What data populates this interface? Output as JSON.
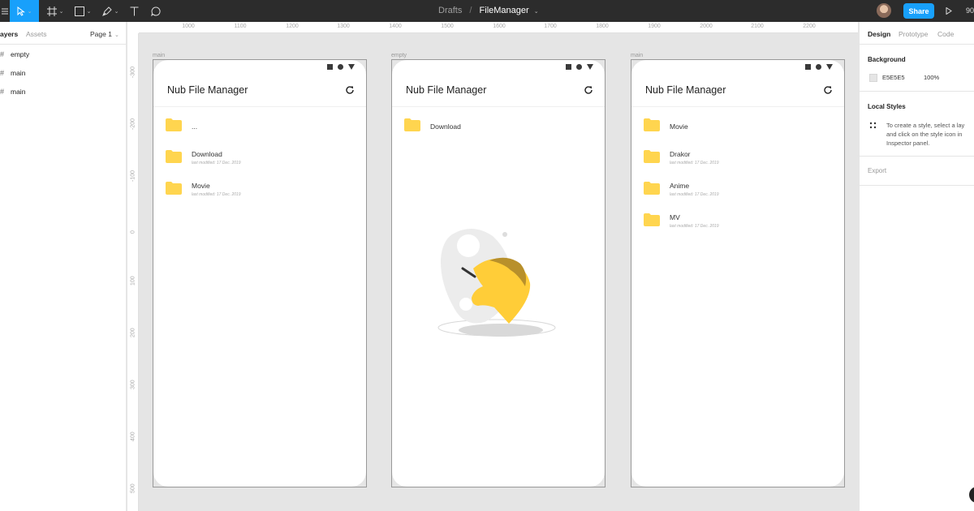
{
  "toolbar": {
    "doc_drafts": "Drafts",
    "doc_sep": "/",
    "doc_name": "FileManager",
    "share_label": "Share",
    "zoom_label": "90"
  },
  "left_panel": {
    "tab_layers": "ayers",
    "tab_assets": "Assets",
    "page_label": "Page 1",
    "layers": [
      {
        "name": "empty"
      },
      {
        "name": "main"
      },
      {
        "name": "main"
      }
    ]
  },
  "canvas": {
    "ruler_top": [
      "1000",
      "1100",
      "1200",
      "1300",
      "1400",
      "1500",
      "1600",
      "1700",
      "1800",
      "1900",
      "2000",
      "2100",
      "2200"
    ],
    "ruler_left": [
      "-300",
      "-200",
      "-100",
      "0",
      "100",
      "200",
      "300",
      "400",
      "500"
    ],
    "frames": [
      {
        "label": "main",
        "title": "Nub File Manager",
        "items": [
          {
            "name": "...",
            "meta": ""
          },
          {
            "name": "Download",
            "meta": "last modified: 17 Dec. 2019"
          },
          {
            "name": "Movie",
            "meta": "last modified: 17 Dec. 2019"
          }
        ]
      },
      {
        "label": "empty",
        "title": "Nub File Manager",
        "items": [
          {
            "name": "Download",
            "meta": ""
          }
        ]
      },
      {
        "label": "main",
        "title": "Nub File Manager",
        "items": [
          {
            "name": "Movie",
            "meta": ""
          },
          {
            "name": "Drakor",
            "meta": "last modified: 17 Dec. 2019"
          },
          {
            "name": "Anime",
            "meta": "last modified: 17 Dec. 2019"
          },
          {
            "name": "MV",
            "meta": "last modified: 17 Dec. 2019"
          }
        ]
      }
    ]
  },
  "right_panel": {
    "tab_design": "Design",
    "tab_prototype": "Prototype",
    "tab_code": "Code",
    "background_heading": "Background",
    "background_hex": "E5E5E5",
    "background_opacity": "100%",
    "local_styles_heading": "Local Styles",
    "local_styles_help": [
      "To create a style, select a lay",
      "and click on the style icon in",
      "Inspector panel."
    ],
    "export_label": "Export"
  },
  "colors": {
    "accent": "#18a0fb",
    "folder": "#ffd54f",
    "canvas_bg": "#e5e5e5",
    "toolbar_bg": "#2c2c2c"
  }
}
